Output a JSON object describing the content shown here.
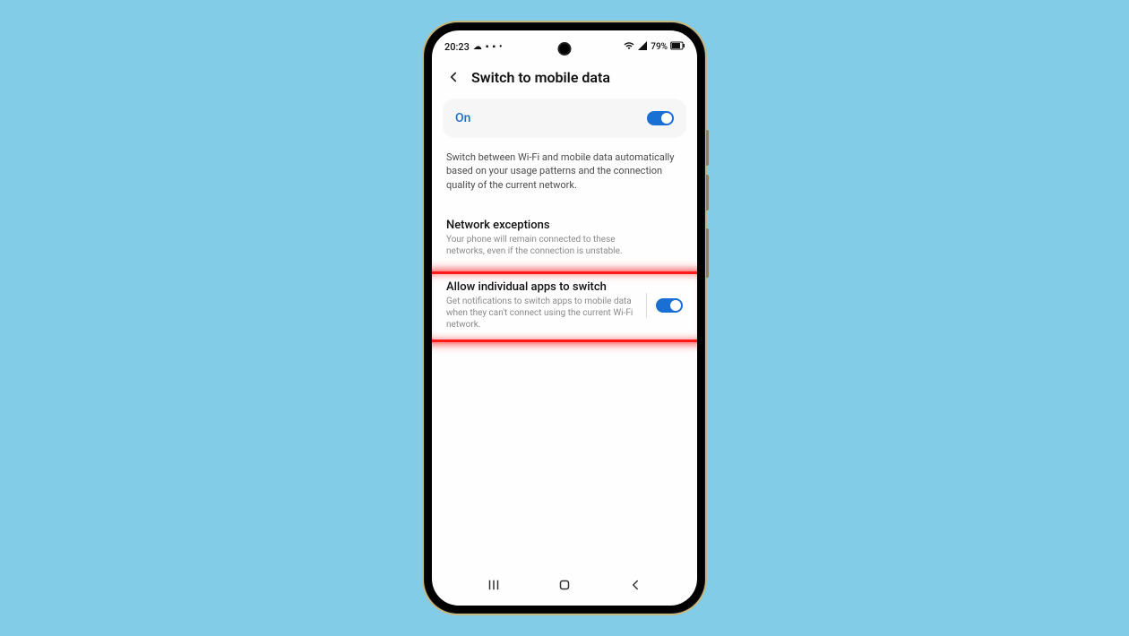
{
  "status_bar": {
    "time": "20:23",
    "left_icons": [
      "cloud-icon",
      "square-icon",
      "square-icon-2",
      "dot-icon"
    ],
    "battery_text": "79%",
    "right_icons": [
      "wifi-icon",
      "signal-icon",
      "battery-icon"
    ]
  },
  "header": {
    "title": "Switch to mobile data"
  },
  "main_toggle": {
    "label": "On",
    "state": true
  },
  "description": "Switch between Wi-Fi and mobile data automatically based on your usage patterns and the connection quality of the current network.",
  "settings": {
    "network_exceptions": {
      "title": "Network exceptions",
      "subtitle": "Your phone will remain connected to these networks, even if the connection is unstable."
    },
    "allow_individual": {
      "title": "Allow individual apps to switch",
      "subtitle": "Get notifications to switch apps to mobile data when they can't connect using the current Wi-Fi network.",
      "state": true
    }
  }
}
